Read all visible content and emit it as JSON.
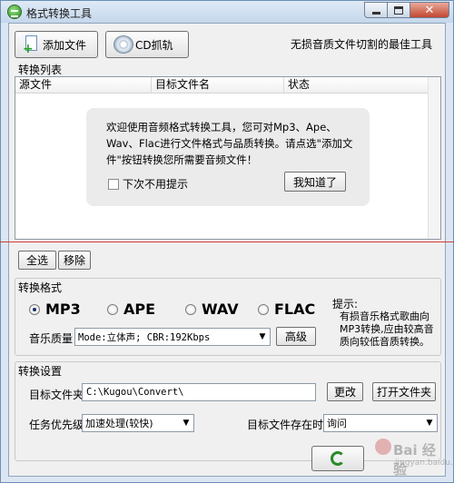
{
  "window": {
    "title": "格式转换工具"
  },
  "toolbar": {
    "add_file_label": "添加文件",
    "cd_rip_label": "CD抓轨",
    "tagline": "无损音质文件切割的最佳工具"
  },
  "file_list": {
    "section_label": "转换列表",
    "columns": [
      "源文件",
      "目标文件名",
      "状态"
    ]
  },
  "tip": {
    "text": "欢迎使用音频格式转换工具，您可对Mp3、Ape、Wav、Flac进行文件格式与品质转换。请点选\"添加文件\"按钮转换您所需要音频文件！",
    "checkbox_label": "下次不用提示",
    "button_label": "我知道了"
  },
  "list_actions": {
    "select_all": "全选",
    "remove": "移除"
  },
  "format": {
    "section_label": "转换格式",
    "options": [
      "MP3",
      "APE",
      "WAV",
      "FLAC"
    ],
    "selected": "MP3",
    "hint_title": "提示:",
    "hint_text": "有损音乐格式歌曲向MP3转换,应由较高音质向较低音质转换。",
    "quality_label": "音乐质量",
    "quality_value": "Mode:立体声; CBR:192Kbps",
    "advanced_label": "高级"
  },
  "settings": {
    "section_label": "转换设置",
    "target_folder_label": "目标文件夹",
    "target_folder_value": "C:\\Kugou\\Convert\\",
    "change_label": "更改",
    "open_folder_label": "打开文件夹",
    "priority_label": "任务优先级",
    "priority_value": "加速处理(较快)",
    "exists_label": "目标文件存在时",
    "exists_value": "询问"
  },
  "watermark": {
    "brand": "Bai 经验",
    "sub": "jingyan.baidu.com"
  }
}
